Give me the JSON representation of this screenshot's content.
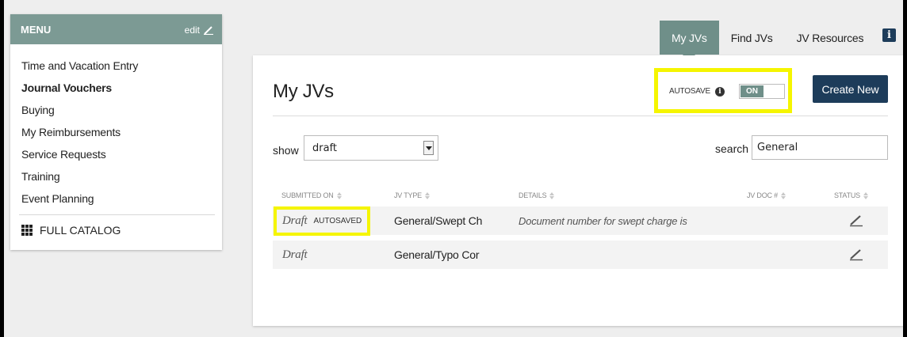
{
  "sidebar": {
    "title": "MENU",
    "edit_label": "edit",
    "items": [
      {
        "label": "Time and Vacation Entry"
      },
      {
        "label": "Journal Vouchers"
      },
      {
        "label": "Buying"
      },
      {
        "label": "My Reimbursements"
      },
      {
        "label": "Service Requests"
      },
      {
        "label": "Training"
      },
      {
        "label": "Event Planning"
      }
    ],
    "full_catalog_label": "FULL CATALOG"
  },
  "nav": {
    "tabs": [
      {
        "label": "My JVs"
      },
      {
        "label": "Find JVs"
      },
      {
        "label": "JV Resources"
      }
    ],
    "info_label": "i"
  },
  "main": {
    "title": "My JVs",
    "autosave_label": "AUTOSAVE",
    "autosave_info": "i",
    "autosave_state": "ON",
    "create_button": "Create New",
    "show_label": "show",
    "show_value": "draft",
    "search_label": "search",
    "search_value": "General"
  },
  "table": {
    "headers": [
      "SUBMITTED ON",
      "JV TYPE",
      "DETAILS",
      "JV DOC #",
      "STATUS"
    ],
    "rows": [
      {
        "submitted": "Draft",
        "tag": "AUTOSAVED",
        "type": "General/Swept Ch",
        "details": "Document number for swept charge is"
      },
      {
        "submitted": "Draft",
        "tag": "",
        "type": "General/Typo Cor",
        "details": ""
      }
    ]
  },
  "colors": {
    "menu_header": "#7c9a94",
    "active_tab": "#6f8f89",
    "primary_button": "#1d3c5a",
    "highlight": "#f5f500"
  }
}
